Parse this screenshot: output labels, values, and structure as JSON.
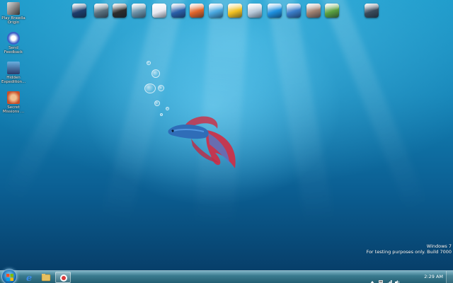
{
  "desktop_icons": [
    {
      "label": "Play Brawlla Origin",
      "icon": "game-icon",
      "color": "#222"
    },
    {
      "label": "Send Feedback",
      "icon": "feedback-icon",
      "color": "#3a5fc8"
    },
    {
      "label": "Hidden Expedition...",
      "icon": "hidden-expedition-icon",
      "color": "#2a3a6a"
    },
    {
      "label": "Secret Missions ...",
      "icon": "secret-missions-icon",
      "color": "#c8502a"
    }
  ],
  "dock_items": [
    {
      "name": "computer-icon",
      "color": "#1e3d6b"
    },
    {
      "name": "documents-icon",
      "color": "#5a6f7c"
    },
    {
      "name": "media-player-icon",
      "color": "#2d2d2d"
    },
    {
      "name": "pictures-icon",
      "color": "#6a8fa5"
    },
    {
      "name": "network-icon",
      "color": "#e8e8f0"
    },
    {
      "name": "search-icon",
      "color": "#2a5fa8"
    },
    {
      "name": "firefox-icon",
      "color": "#e0652a"
    },
    {
      "name": "twitter-bird-icon",
      "color": "#4aa8e0"
    },
    {
      "name": "notes-icon",
      "color": "#f0c020"
    },
    {
      "name": "editor-icon",
      "color": "#b8c8d8"
    },
    {
      "name": "skype-icon",
      "color": "#1e90e0"
    },
    {
      "name": "swirl-icon",
      "color": "#3a7cc8"
    },
    {
      "name": "face-icon",
      "color": "#a08070"
    },
    {
      "name": "recycle-icon",
      "color": "#5aa040"
    },
    {
      "name": "recycle-bin-icon",
      "color": "#3a4a5a"
    }
  ],
  "watermark": {
    "line1": "Windows 7",
    "line2": "For testing purposes only. Build 7000"
  },
  "taskbar": {
    "pinned": [
      {
        "name": "internet-explorer-icon",
        "color": "#2a7ad8"
      },
      {
        "name": "explorer-folder-icon",
        "color": "#e8c060"
      },
      {
        "name": "media-app-icon",
        "color": "#d83a3a"
      }
    ],
    "clock": "2:29 AM"
  }
}
